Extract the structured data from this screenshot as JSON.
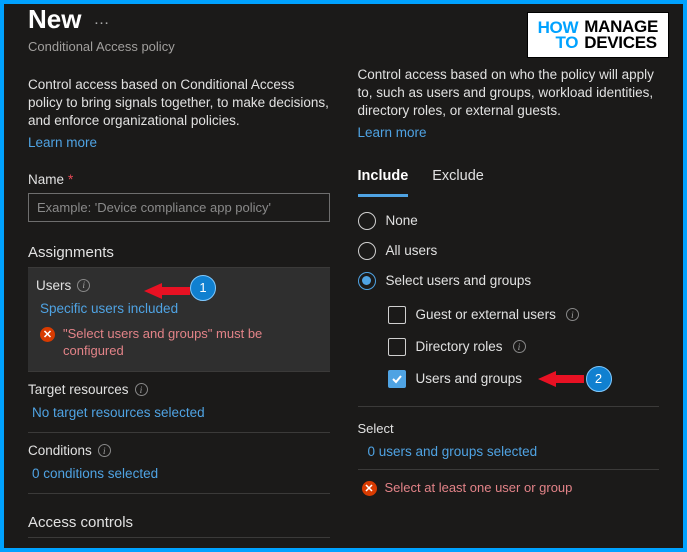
{
  "header": {
    "title": "New",
    "subtitle": "Conditional Access policy",
    "ellipsis": "…"
  },
  "left": {
    "desc": "Control access based on Conditional Access policy to bring signals together, to make decisions, and enforce organizational policies.",
    "learn_more": "Learn more",
    "name_label": "Name",
    "name_placeholder": "Example: 'Device compliance app policy'",
    "assignments_hdr": "Assignments",
    "users": {
      "label": "Users",
      "value": "Specific users included",
      "error": "\"Select users and groups\" must be configured"
    },
    "target": {
      "label": "Target resources",
      "value": "No target resources selected"
    },
    "conditions": {
      "label": "Conditions",
      "value": "0 conditions selected"
    },
    "access_hdr": "Access controls"
  },
  "right": {
    "desc": "Control access based on who the policy will apply to, such as users and groups, workload identities, directory roles, or external guests.",
    "learn_more": "Learn more",
    "tabs": {
      "include": "Include",
      "exclude": "Exclude"
    },
    "opts": {
      "none": "None",
      "all": "All users",
      "select": "Select users and groups",
      "guest": "Guest or external users",
      "roles": "Directory roles",
      "usersgroups": "Users and groups"
    },
    "select_hdr": "Select",
    "select_value": "0 users and groups selected",
    "select_error": "Select at least one user or group"
  },
  "annotations": {
    "one": "1",
    "two": "2"
  },
  "logo": {
    "how": "HOW",
    "to": "TO",
    "manage": "MANAGE",
    "devices": "DEVICES"
  }
}
